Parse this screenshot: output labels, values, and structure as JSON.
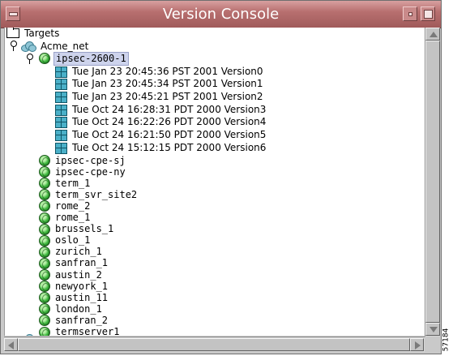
{
  "window": {
    "title": "Version Console"
  },
  "tree": {
    "root": "Targets",
    "network": "Acme_net",
    "selected_device": "ipsec-2600-1",
    "versions": [
      "Tue Jan 23 20:45:36 PST 2001 Version0",
      "Tue Jan 23 20:45:34 PST 2001 Version1",
      "Tue Jan 23 20:45:21 PST 2001 Version2",
      "Tue Oct 24 16:28:31 PDT 2000 Version3",
      "Tue Oct 24 16:22:26 PDT 2000 Version4",
      "Tue Oct 24 16:21:50 PDT 2000 Version5",
      "Tue Oct 24 15:12:15 PDT 2000 Version6"
    ],
    "devices": [
      "ipsec-cpe-sj",
      "ipsec-cpe-ny",
      "term_1",
      "term_svr_site2",
      "rome_2",
      "rome_1",
      "brussels_1",
      "oslo_1",
      "zurich_1",
      "sanfran_1",
      "austin_2",
      "newyork_1",
      "austin_11",
      "london_1",
      "sanfran_2",
      "termserver1"
    ]
  },
  "figure_id": "57184",
  "icons": {
    "root": "folder-icon",
    "network": "cloud-icon",
    "device": "router-globe-icon",
    "version": "config-version-icon",
    "expander": "tree-expand-handle-icon"
  }
}
